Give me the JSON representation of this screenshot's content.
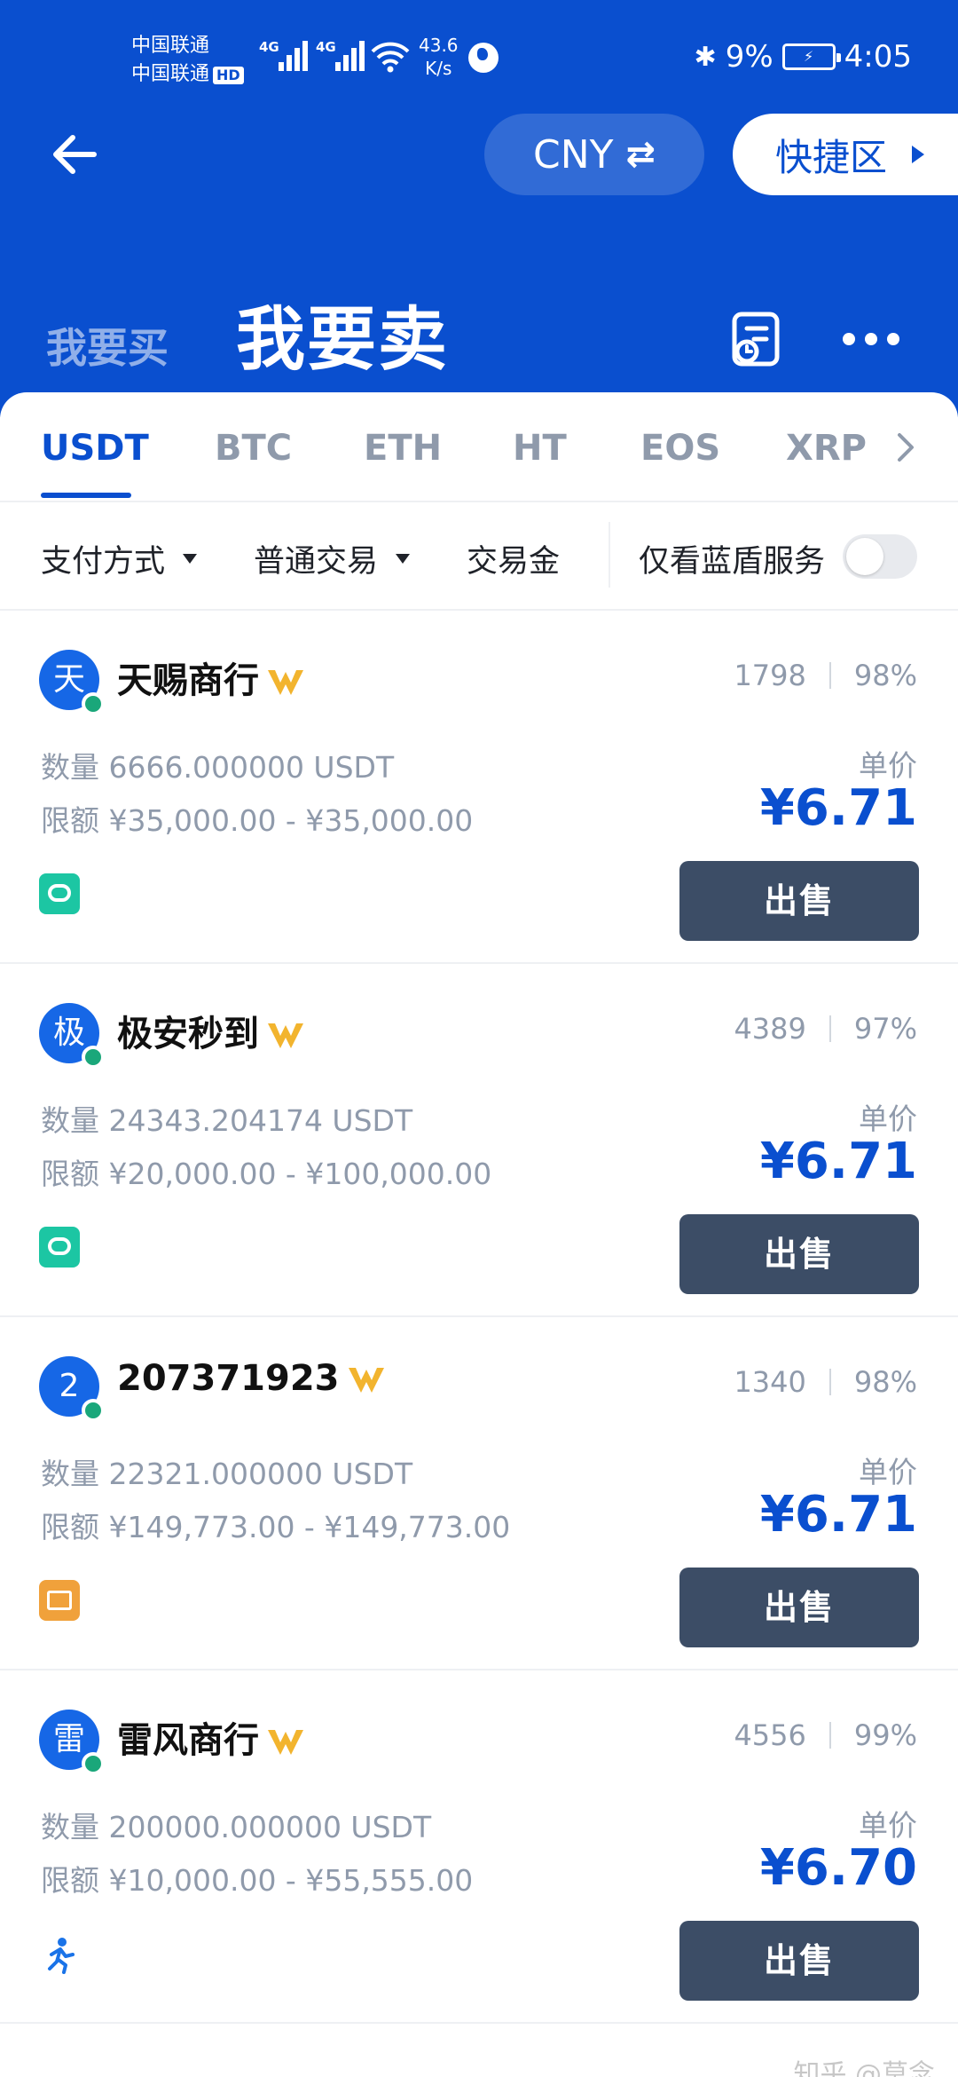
{
  "status_bar": {
    "carrier1": "中国联通",
    "carrier2": "中国联通",
    "hd_badge": "HD",
    "net1": "4G",
    "net2": "4G",
    "speed_value": "43.6",
    "speed_unit": "K/s",
    "battery_percent": "9%",
    "time": "4:05"
  },
  "header": {
    "currency": "CNY",
    "quick_area": "快捷区",
    "tab_buy": "我要买",
    "tab_sell": "我要卖"
  },
  "coin_tabs": [
    "USDT",
    "BTC",
    "ETH",
    "HT",
    "EOS",
    "XRP"
  ],
  "active_coin": "USDT",
  "filters": {
    "payment": "支付方式",
    "trade_type": "普通交易",
    "amount": "交易金",
    "blue_shield": "仅看蓝盾服务",
    "blue_shield_on": false
  },
  "listings": [
    {
      "avatar": "天",
      "name": "天赐商行",
      "orders": "1798",
      "rate": "98%",
      "qty_label": "数量",
      "qty": "6666.000000 USDT",
      "limit_label": "限额",
      "limit": "¥35,000.00 - ¥35,000.00",
      "unit_label": "单价",
      "price": "¥6.71",
      "pay": "chat",
      "action": "出售"
    },
    {
      "avatar": "极",
      "name": "极安秒到",
      "orders": "4389",
      "rate": "97%",
      "qty_label": "数量",
      "qty": "24343.204174 USDT",
      "limit_label": "限额",
      "limit": "¥20,000.00 - ¥100,000.00",
      "unit_label": "单价",
      "price": "¥6.71",
      "pay": "chat",
      "action": "出售"
    },
    {
      "avatar": "2",
      "name": "207371923",
      "orders": "1340",
      "rate": "98%",
      "qty_label": "数量",
      "qty": "22321.000000 USDT",
      "limit_label": "限额",
      "limit": "¥149,773.00 - ¥149,773.00",
      "unit_label": "单价",
      "price": "¥6.71",
      "pay": "card",
      "action": "出售"
    },
    {
      "avatar": "雷",
      "name": "雷风商行",
      "orders": "4556",
      "rate": "99%",
      "qty_label": "数量",
      "qty": "200000.000000 USDT",
      "limit_label": "限额",
      "limit": "¥10,000.00 - ¥55,555.00",
      "unit_label": "单价",
      "price": "¥6.70",
      "pay": "run",
      "action": "出售"
    }
  ],
  "watermark": "知乎 @莫念",
  "colors": {
    "brand_blue": "#0a4fcf",
    "sell_button": "#3c4d66",
    "online_dot": "#1aa77a",
    "vip_gold": "#f2b42e"
  }
}
